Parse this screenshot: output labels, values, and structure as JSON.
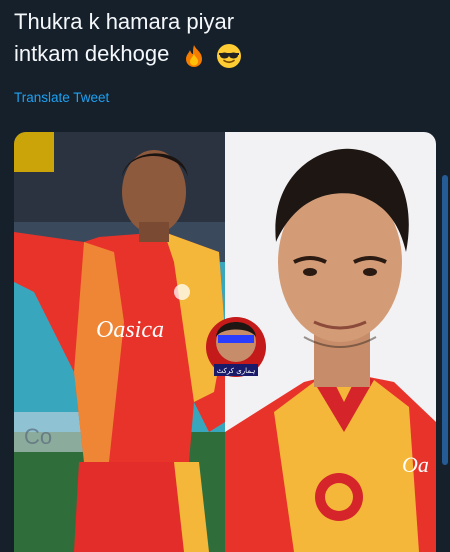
{
  "tweet": {
    "line1": "Thukra k hamara piyar",
    "line2": "intkam dekhoge",
    "emojis": [
      "fire-emoji",
      "sunglasses-emoji"
    ]
  },
  "translate_label": "Translate Tweet",
  "media": {
    "left_jersey_text": "Oasica",
    "badge_caption": "ہماری کرکٹ",
    "right_jersey_text": "Oa"
  },
  "colors": {
    "background": "#15202b",
    "text": "#f5f8fa",
    "link": "#1da1f2",
    "jersey_red": "#e8332a",
    "jersey_yellow": "#f4b73a"
  }
}
